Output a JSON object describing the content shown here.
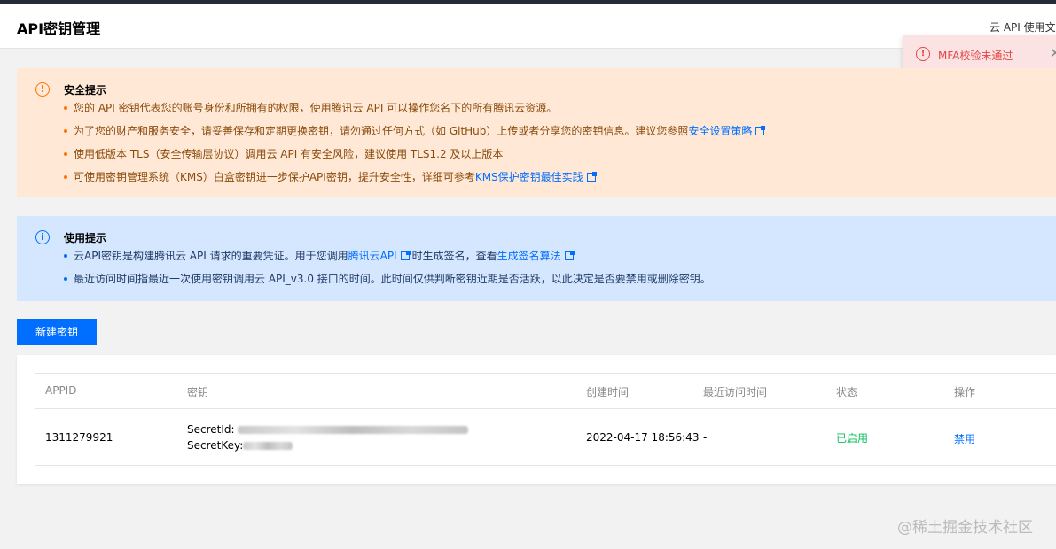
{
  "header": {
    "title": "API密钥管理",
    "doc_link": "云 API 使用文档"
  },
  "toast": {
    "message": "MFA校验未通过",
    "icon": "alert-circle-icon",
    "close_icon": "close-icon"
  },
  "security_tip": {
    "title": "安全提示",
    "items": [
      {
        "text": "您的 API 密钥代表您的账号身份和所拥有的权限，使用腾讯云 API 可以操作您名下的所有腾讯云资源。"
      },
      {
        "text": "为了您的财产和服务安全，请妥善保存和定期更换密钥，请勿通过任何方式（如 GitHub）上传或者分享您的密钥信息。建议您参照",
        "link": "安全设置策略"
      },
      {
        "text": "使用低版本 TLS（安全传输层协议）调用云 API 有安全风险，建议使用 TLS1.2 及以上版本"
      },
      {
        "text": "可使用密钥管理系统（KMS）白盒密钥进一步保护API密钥，提升安全性，详细可参考",
        "link": "KMS保护密钥最佳实践"
      }
    ]
  },
  "usage_tip": {
    "title": "使用提示",
    "items": [
      {
        "text_a": "云API密钥是构建腾讯云 API 请求的重要凭证。用于您调用",
        "link_a": "腾讯云API",
        "text_b": "时生成签名，查看",
        "link_b": "生成签名算法"
      },
      {
        "text": "最近访问时间指最近一次使用密钥调用云 API_v3.0 接口的时间。此时间仅供判断密钥近期是否活跃，以此决定是否要禁用或删除密钥。"
      }
    ]
  },
  "create_button": "新建密钥",
  "table": {
    "columns": [
      "APPID",
      "密钥",
      "创建时间",
      "最近访问时间",
      "状态",
      "操作"
    ],
    "rows": [
      {
        "appid": "1311279921",
        "secret_id_label": "SecretId:",
        "secret_key_label": "SecretKey:",
        "created": "2022-04-17 18:56:43",
        "last_access": "-",
        "status": "已启用",
        "action": "禁用"
      }
    ]
  },
  "watermark": "@稀土掘金技术社区",
  "colors": {
    "accent": "#006eff",
    "warning": "#ff7200",
    "error": "#e54545",
    "success": "#0abf5b"
  }
}
